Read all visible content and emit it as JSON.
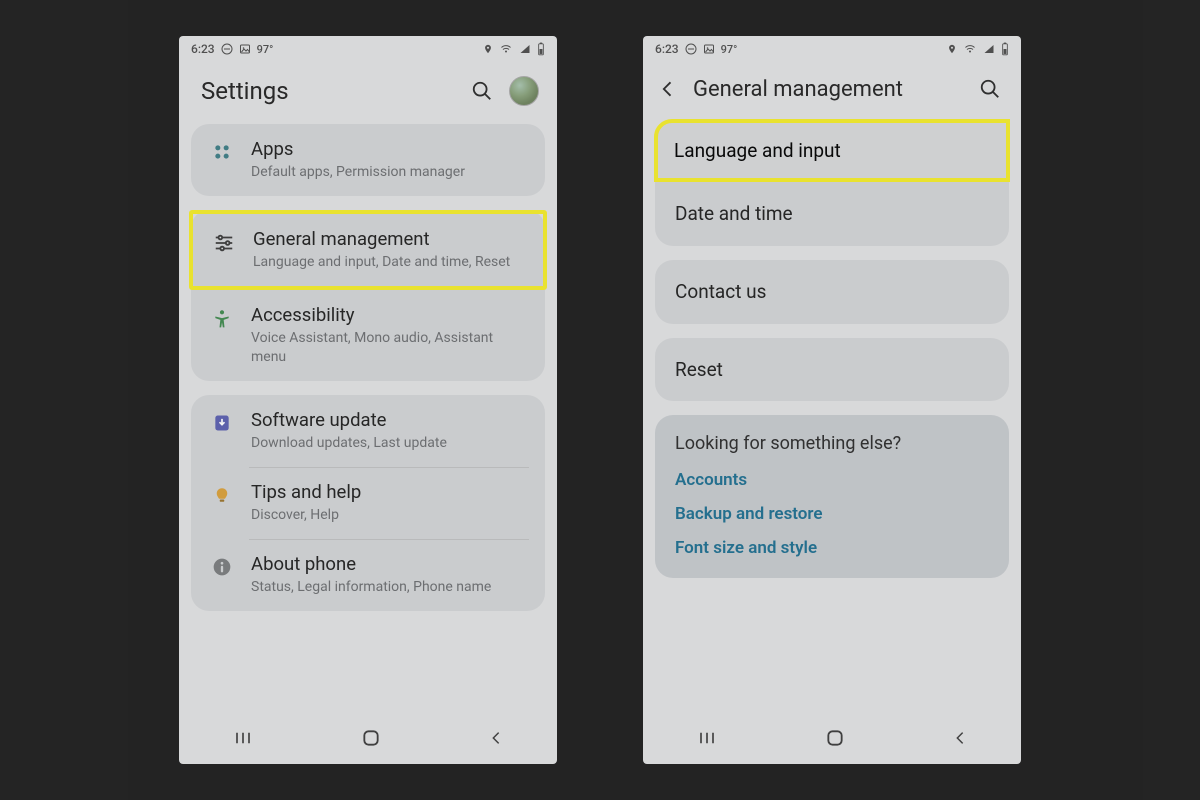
{
  "status": {
    "time": "6:23",
    "temp": "97°"
  },
  "left": {
    "title": "Settings",
    "items": [
      {
        "label": "Apps",
        "sub": "Default apps, Permission manager"
      },
      {
        "label": "General management",
        "sub": "Language and input, Date and time, Reset"
      },
      {
        "label": "Accessibility",
        "sub": "Voice Assistant, Mono audio, Assistant menu"
      },
      {
        "label": "Software update",
        "sub": "Download updates, Last update"
      },
      {
        "label": "Tips and help",
        "sub": "Discover, Help"
      },
      {
        "label": "About phone",
        "sub": "Status, Legal information, Phone name"
      }
    ]
  },
  "right": {
    "title": "General management",
    "items": [
      {
        "label": "Language and input"
      },
      {
        "label": "Date and time"
      },
      {
        "label": "Contact us"
      },
      {
        "label": "Reset"
      }
    ],
    "looking": {
      "heading": "Looking for something else?",
      "links": [
        "Accounts",
        "Backup and restore",
        "Font size and style"
      ]
    }
  }
}
